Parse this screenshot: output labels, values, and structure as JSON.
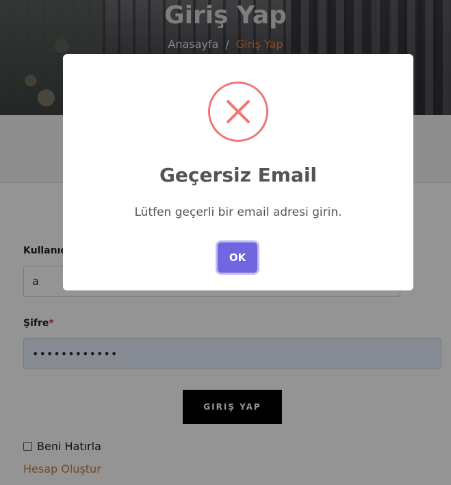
{
  "hero": {
    "title": "Giriş Yap",
    "breadcrumb": [
      "Anasayfa",
      "/",
      "Giriş Yap"
    ]
  },
  "form": {
    "username_label": "Kullanıcı Adı veya Email",
    "username_value": "a",
    "password_label": "Şifre",
    "password_required": "*",
    "password_value": "************",
    "login_button": "GIRIŞ YAP",
    "remember_label": "Beni Hatırla",
    "remember_checked": false,
    "create_account_link": "Hesap Oluştur"
  },
  "modal": {
    "icon": "error-x-icon",
    "title": "Geçersiz Email",
    "text": "Lütfen geçerli bir email adresi girin.",
    "ok_button": "OK"
  },
  "colors": {
    "accent_orange": "#e8843c",
    "error_red": "#f27474",
    "confirm_purple": "#7066e0"
  }
}
